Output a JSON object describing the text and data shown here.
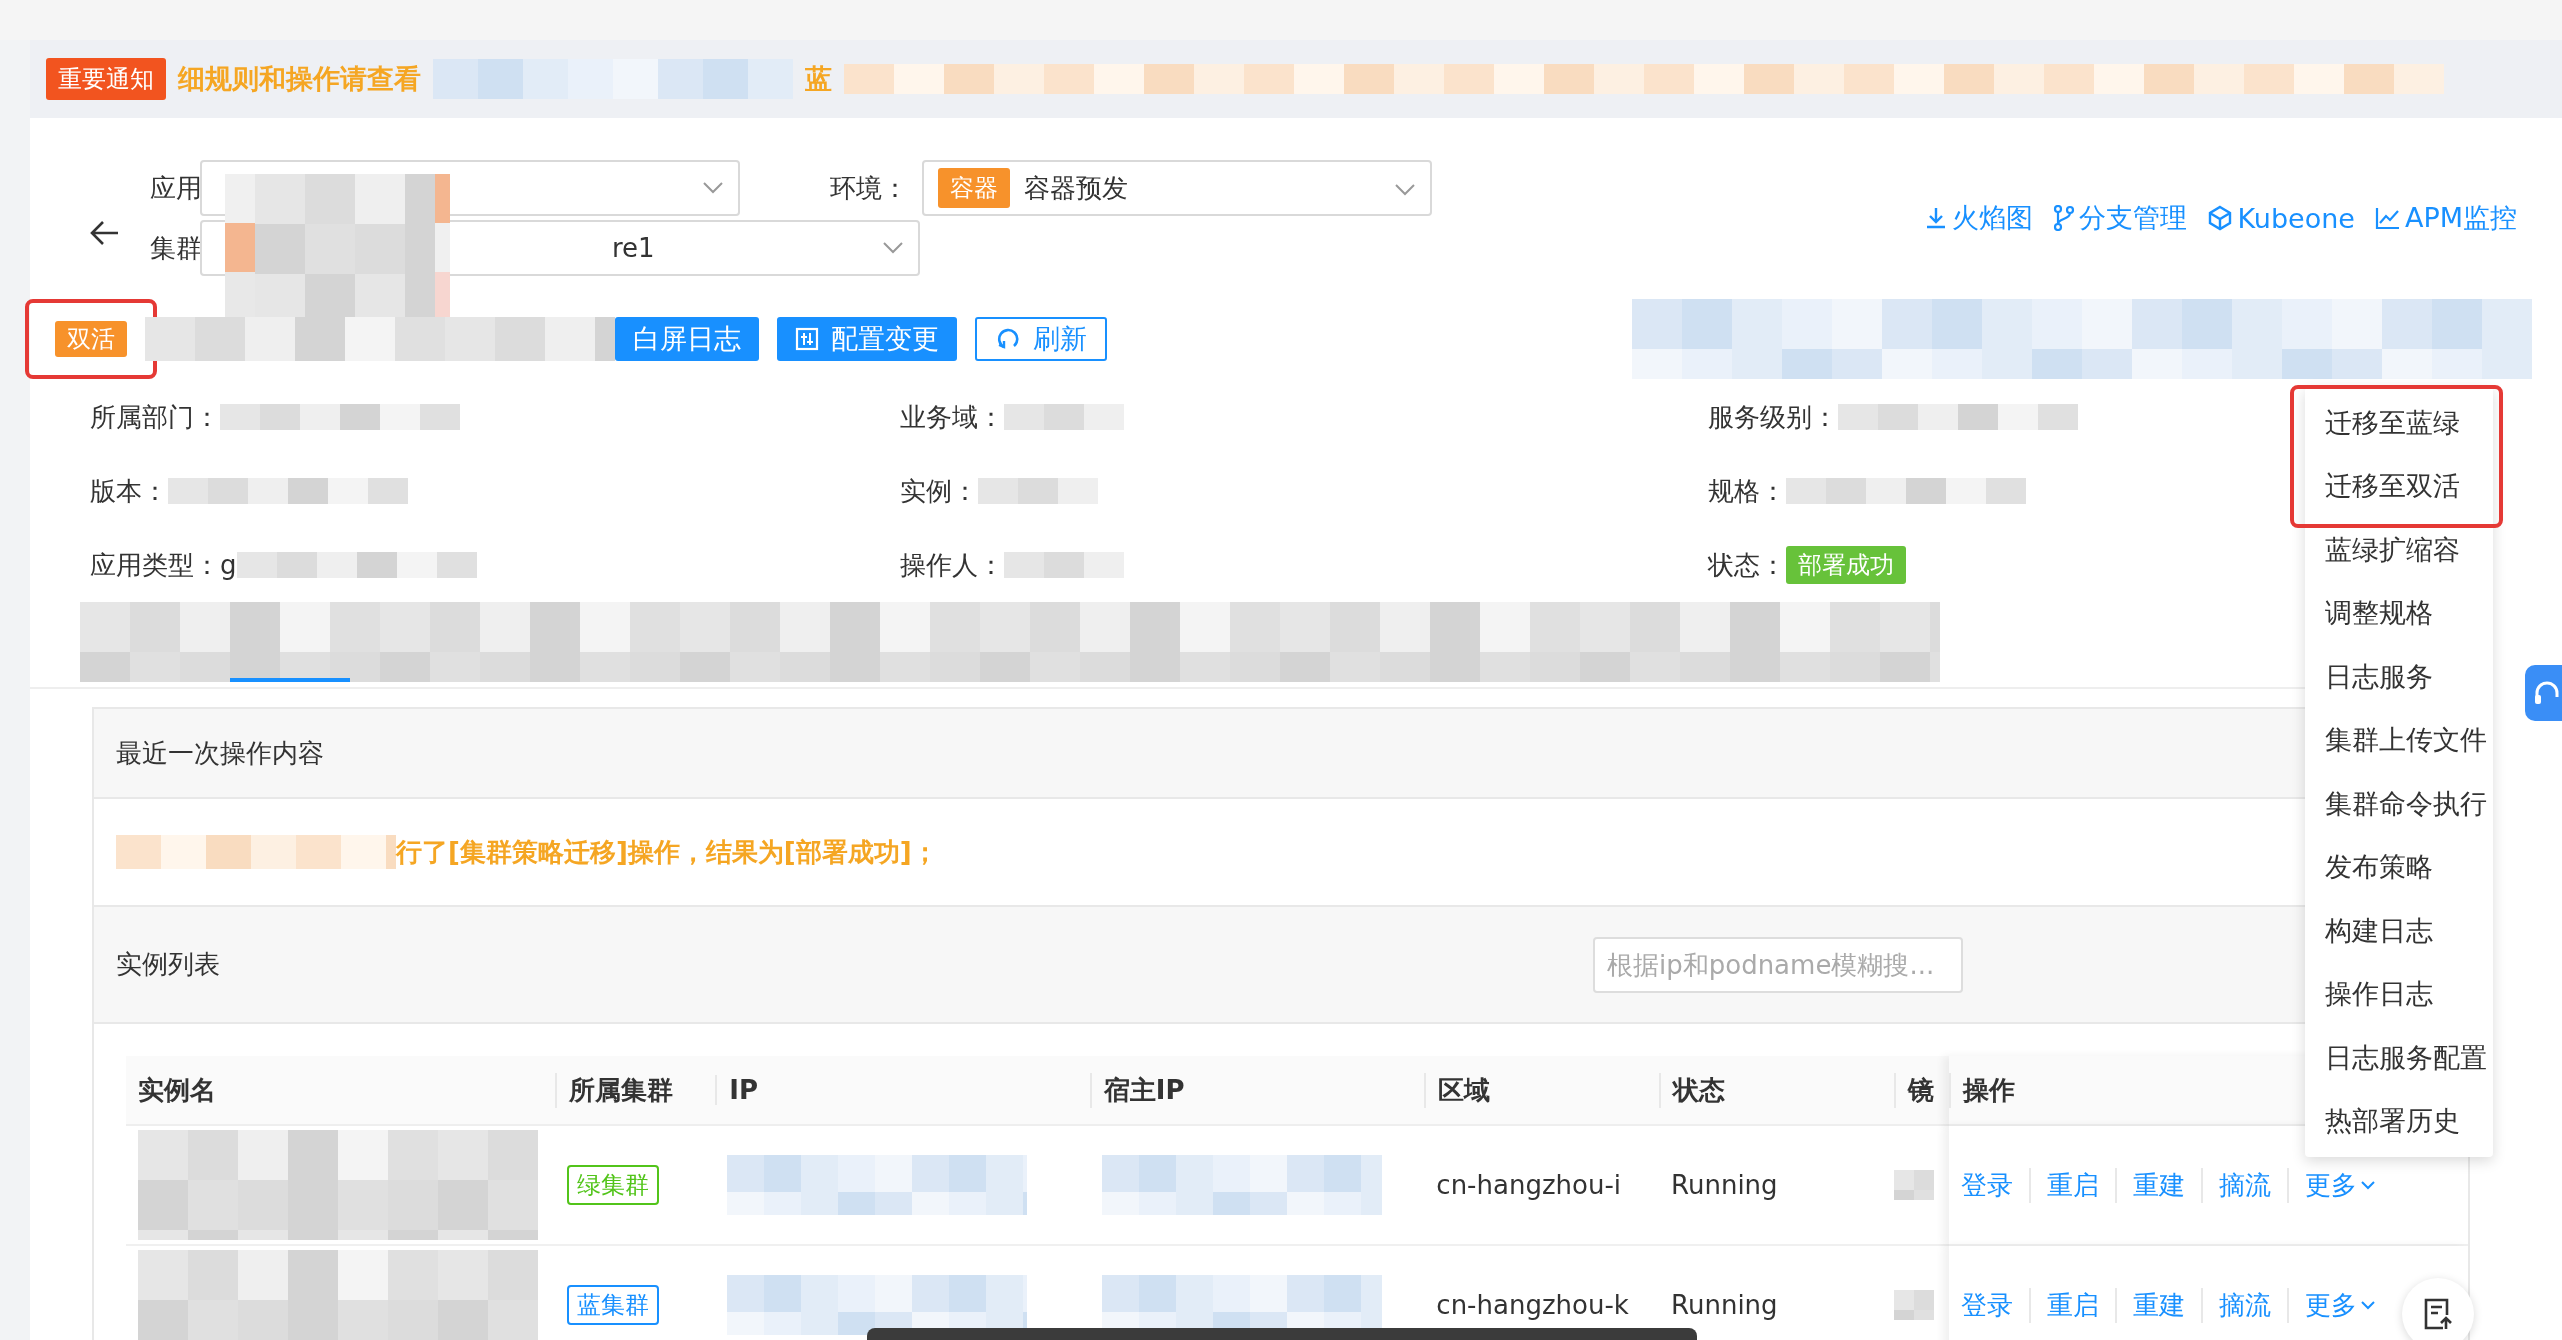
{
  "notice": {
    "badge": "重要通知",
    "text": "细规则和操作请查看",
    "text_tail": "蓝"
  },
  "header": {
    "app_label": "应用",
    "cluster_label": "集群",
    "cluster_value": "re1",
    "env_label": "环境：",
    "env_tag": "容器",
    "env_value": "容器预发",
    "links": [
      {
        "label": "火焰图"
      },
      {
        "label": "分支管理"
      },
      {
        "label": "Kubeone"
      },
      {
        "label": "APM监控"
      }
    ]
  },
  "mode_tag": {
    "label": "双活",
    "highlighted": true
  },
  "actions": [
    {
      "kind": "primary",
      "label": "白屏日志"
    },
    {
      "kind": "primary",
      "label": "配置变更"
    },
    {
      "kind": "outline",
      "label": "刷新"
    }
  ],
  "info": [
    {
      "label": "所属部门："
    },
    {
      "label": "业务域："
    },
    {
      "label": "服务级别："
    },
    {
      "label": "版本："
    },
    {
      "label": "实例："
    },
    {
      "label": "规格："
    },
    {
      "label": "应用类型：",
      "value": "g"
    },
    {
      "label": "操作人："
    },
    {
      "label": "状态：",
      "status": "部署成功"
    }
  ],
  "last_op": {
    "title": "最近一次操作内容",
    "text": "行了[集群策略迁移]操作，结果为[部署成功]；"
  },
  "instances": {
    "title": "实例列表",
    "search_placeholder": "根据ip和podname模糊搜...",
    "columns": [
      "实例名",
      "所属集群",
      "IP",
      "宿主IP",
      "区域",
      "状态",
      "镜",
      "操作"
    ],
    "rows": [
      {
        "cluster": "绿集群",
        "color": "#52c41a",
        "region": "cn-hangzhou-i",
        "status": "Running",
        "actions": [
          "登录",
          "重启",
          "重建",
          "摘流",
          "更多"
        ]
      },
      {
        "cluster": "蓝集群",
        "color": "#1890ff",
        "region": "cn-hangzhou-k",
        "status": "Running",
        "actions": [
          "登录",
          "重启",
          "重建",
          "摘流",
          "更多"
        ]
      }
    ]
  },
  "menu": {
    "items": [
      {
        "label": "迁移至蓝绿",
        "highlighted": true
      },
      {
        "label": "迁移至双活",
        "highlighted": true
      },
      {
        "label": "蓝绿扩缩容",
        "highlighted": false
      },
      {
        "label": "调整规格",
        "highlighted": false
      },
      {
        "label": "日志服务",
        "highlighted": false
      },
      {
        "label": "集群上传文件",
        "highlighted": false
      },
      {
        "label": "集群命令执行",
        "highlighted": false
      },
      {
        "label": "发布策略",
        "highlighted": false
      },
      {
        "label": "构建日志",
        "highlighted": false
      },
      {
        "label": "操作日志",
        "highlighted": false
      },
      {
        "label": "日志服务配置",
        "highlighted": false
      },
      {
        "label": "热部署历史",
        "highlighted": false
      }
    ]
  }
}
